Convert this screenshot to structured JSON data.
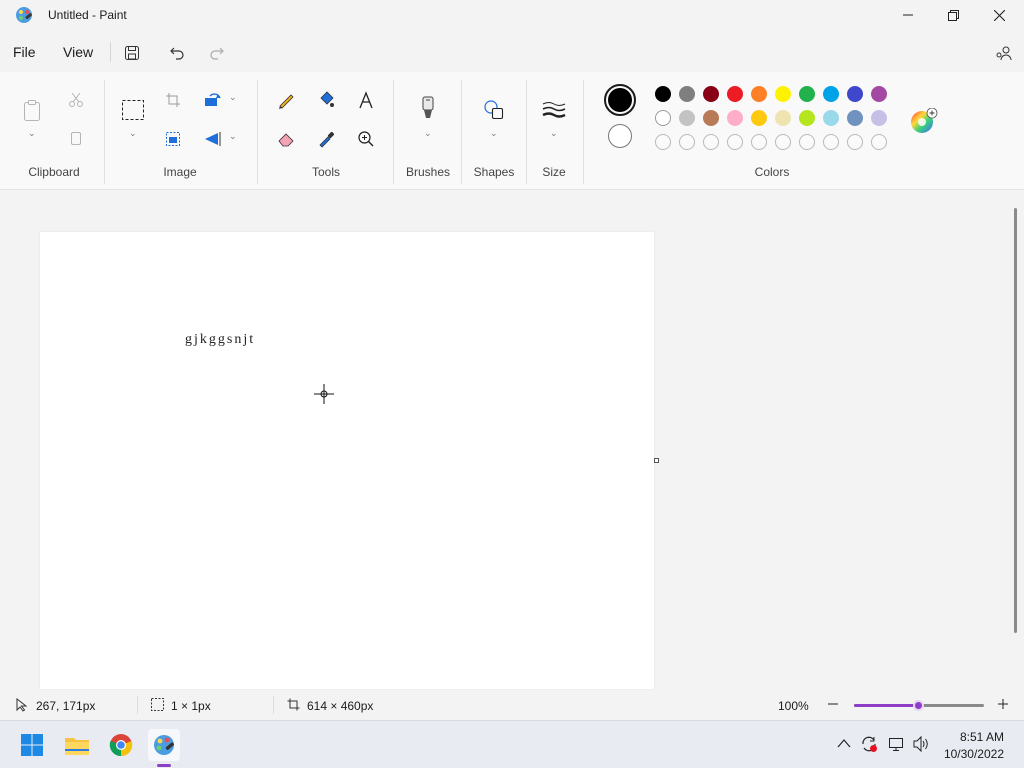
{
  "window": {
    "title": "Untitled - Paint",
    "controls": [
      "minimize-icon",
      "restore-icon",
      "close-icon"
    ]
  },
  "menu": {
    "file": "File",
    "view": "View",
    "icons": [
      "save-icon",
      "undo-icon",
      "redo-icon",
      "share-icon"
    ]
  },
  "ribbon": {
    "groups": {
      "clipboard": "Clipboard",
      "image": "Image",
      "tools": "Tools",
      "brushes": "Brushes",
      "shapes": "Shapes",
      "size": "Size",
      "colors": "Colors"
    },
    "primary_color": "#000000",
    "secondary_color": "#ffffff",
    "palette": [
      [
        "#000000",
        "#7f7f7f",
        "#880015",
        "#ed1c24",
        "#ff7f27",
        "#fff200",
        "#22b14c",
        "#00a2e8",
        "#3f48cc",
        "#a349a4"
      ],
      [
        "#ffffff",
        "#c3c3c3",
        "#b97a57",
        "#ffaec9",
        "#ffc90e",
        "#efe4b0",
        "#b5e61d",
        "#99d9ea",
        "#7092be",
        "#c8bfe7"
      ],
      [
        "",
        "",
        "",
        "",
        "",
        "",
        "",
        "",
        "",
        ""
      ]
    ]
  },
  "canvas": {
    "text": "gjkggsnjt"
  },
  "status": {
    "cursor_position": "267, 171px",
    "selection_size": "1 × 1px",
    "canvas_size": "614 × 460px",
    "zoom": "100%",
    "zoom_fraction": 0.5
  },
  "taskbar": {
    "apps": [
      "windows-start-icon",
      "file-explorer-icon",
      "chrome-icon",
      "paint-icon"
    ],
    "time": "8:51 AM",
    "date": "10/30/2022"
  }
}
